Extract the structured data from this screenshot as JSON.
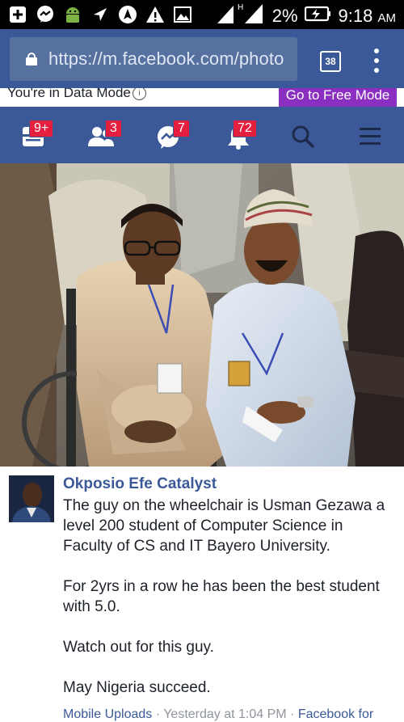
{
  "status_bar": {
    "battery": "2%",
    "time": "9:18",
    "ampm": "AM",
    "network": "H",
    "icons": [
      "add-icon",
      "messenger-icon",
      "android-icon",
      "location-icon",
      "navigation-icon",
      "warning-icon",
      "image-icon",
      "signal-icon",
      "battery-charging-icon"
    ]
  },
  "browser": {
    "url": "https://m.facebook.com/photo",
    "tab_count": "38"
  },
  "data_mode": {
    "text": "You're in Data Mode",
    "button": "Go to Free Mode"
  },
  "nav": {
    "items": [
      {
        "icon": "news-feed-icon",
        "badge": "9+"
      },
      {
        "icon": "friend-requests-icon",
        "badge": "3"
      },
      {
        "icon": "messages-icon",
        "badge": "7"
      },
      {
        "icon": "notifications-icon",
        "badge": "72"
      },
      {
        "icon": "search-icon",
        "badge": ""
      },
      {
        "icon": "menu-icon",
        "badge": ""
      }
    ],
    "accent": "#3b5998",
    "badge_color": "#e41e3f"
  },
  "post": {
    "author": "Okposio Efe Catalyst",
    "paragraphs": [
      "The guy on the wheelchair is Usman Gezawa a level 200 student of Computer Science in Faculty of CS and IT Bayero University.",
      "For 2yrs in a row he has been the best student with 5.0.",
      "Watch out for this guy.",
      "May Nigeria succeed."
    ],
    "footer": {
      "album": "Mobile Uploads",
      "sep1": " · ",
      "time": "Yesterday at 1:04 PM",
      "sep2": " · ",
      "via": "Facebook for"
    }
  }
}
